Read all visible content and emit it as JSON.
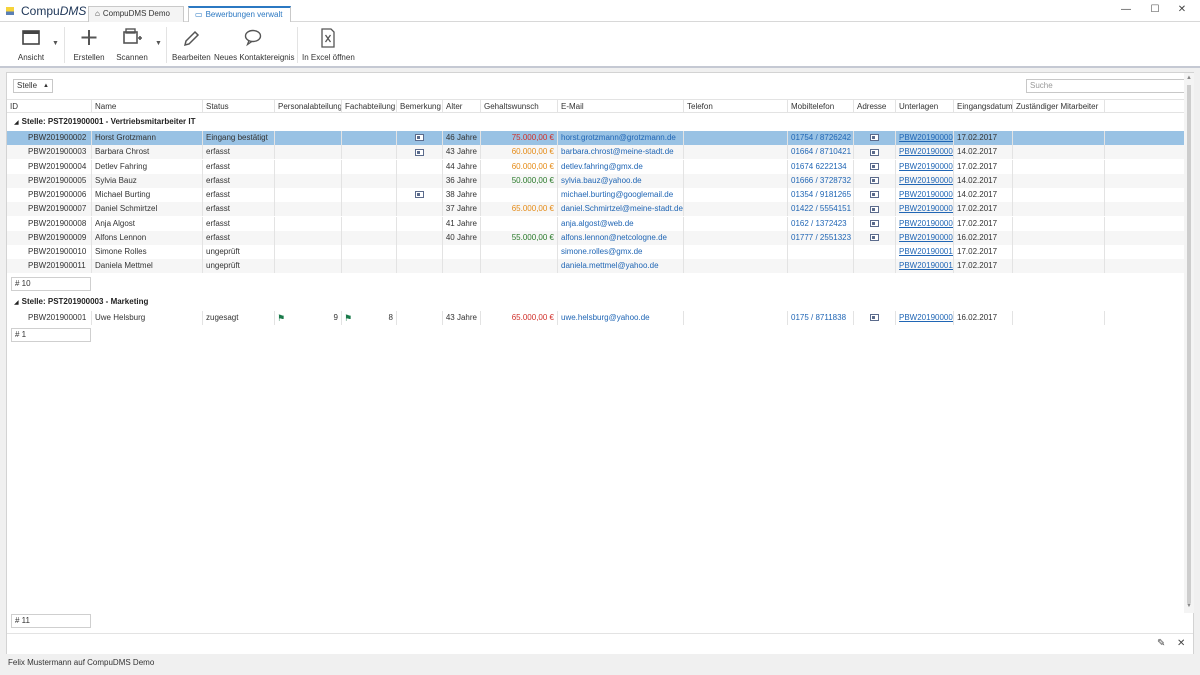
{
  "app": {
    "name_plain": "Compu",
    "name_italic": "DMS",
    "tabs": [
      {
        "label": "CompuDMS Demo",
        "icon": "home-icon"
      },
      {
        "label": "Bewerbungen verwalt",
        "icon": "document-icon"
      }
    ],
    "window_controls": {
      "minimize": "—",
      "maximize": "☐",
      "close": "✕"
    }
  },
  "ribbon": {
    "buttons": [
      {
        "label": "Ansicht",
        "icon": "window-icon",
        "has_dropdown": true
      },
      {
        "label": "Erstellen",
        "icon": "plus-icon",
        "has_dropdown": false
      },
      {
        "label": "Scannen",
        "icon": "scanner-icon",
        "has_dropdown": true
      },
      {
        "label": "Bearbeiten",
        "icon": "pencil-icon",
        "has_dropdown": false
      },
      {
        "label": "Neues Kontaktereignis",
        "icon": "speech-bubble-icon",
        "has_dropdown": false
      },
      {
        "label": "In Excel öffnen",
        "icon": "excel-icon",
        "has_dropdown": false
      }
    ]
  },
  "toolbar": {
    "group_by": "Stelle",
    "search_placeholder": "Suche"
  },
  "columns": [
    "ID",
    "Name",
    "Status",
    "Personalabteilung",
    "Fachabteilung",
    "Bemerkung",
    "Alter",
    "Gehaltswunsch",
    "E-Mail",
    "Telefon",
    "Mobiltelefon",
    "Adresse",
    "Unterlagen",
    "Eingangsdatum",
    "Zuständiger Mitarbeiter"
  ],
  "groups": [
    {
      "title": "Stelle: PST201900001 - Vertriebsmitarbeiter IT",
      "count_label": "# 10",
      "rows": [
        {
          "id": "PBW201900002",
          "name": "Horst Grotzmann",
          "status": "Eingang bestätigt",
          "personal": "",
          "fach": "",
          "bemerkung": true,
          "alter": "46 Jahre",
          "gehalt": "75.000,00 €",
          "gehalt_color": "#d0302a",
          "email": "horst.grotzmann@grotzmann.de",
          "telefon": "",
          "mobil": "01754 / 8726242",
          "adresse": true,
          "unterlagen": "PBW201900002",
          "datum": "17.02.2017",
          "mitarbeiter": "",
          "selected": true
        },
        {
          "id": "PBW201900003",
          "name": "Barbara Chrost",
          "status": "erfasst",
          "personal": "",
          "fach": "",
          "bemerkung": true,
          "alter": "43 Jahre",
          "gehalt": "60.000,00 €",
          "gehalt_color": "#e58b16",
          "email": "barbara.chrost@meine-stadt.de",
          "telefon": "",
          "mobil": "01664 / 8710421",
          "adresse": true,
          "unterlagen": "PBW201900003",
          "datum": "14.02.2017",
          "mitarbeiter": ""
        },
        {
          "id": "PBW201900004",
          "name": "Detlev Fahring",
          "status": "erfasst",
          "personal": "",
          "fach": "",
          "bemerkung": false,
          "alter": "44 Jahre",
          "gehalt": "60.000,00 €",
          "gehalt_color": "#e58b16",
          "email": "detlev.fahring@gmx.de",
          "telefon": "",
          "mobil": "01674 6222134",
          "adresse": true,
          "unterlagen": "PBW201900004",
          "datum": "17.02.2017",
          "mitarbeiter": ""
        },
        {
          "id": "PBW201900005",
          "name": "Sylvia Bauz",
          "status": "erfasst",
          "personal": "",
          "fach": "",
          "bemerkung": false,
          "alter": "36 Jahre",
          "gehalt": "50.000,00 €",
          "gehalt_color": "#2a7a2a",
          "email": "sylvia.bauz@yahoo.de",
          "telefon": "",
          "mobil": "01666 / 3728732",
          "adresse": true,
          "unterlagen": "PBW201900005",
          "datum": "14.02.2017",
          "mitarbeiter": ""
        },
        {
          "id": "PBW201900006",
          "name": "Michael Burting",
          "status": "erfasst",
          "personal": "",
          "fach": "",
          "bemerkung": true,
          "alter": "38 Jahre",
          "gehalt": "",
          "gehalt_color": "#333333",
          "email": "michael.burting@googlemail.de",
          "telefon": "",
          "mobil": "01354 / 9181265",
          "adresse": true,
          "unterlagen": "PBW201900006",
          "datum": "14.02.2017",
          "mitarbeiter": ""
        },
        {
          "id": "PBW201900007",
          "name": "Daniel Schmirtzel",
          "status": "erfasst",
          "personal": "",
          "fach": "",
          "bemerkung": false,
          "alter": "37 Jahre",
          "gehalt": "65.000,00 €",
          "gehalt_color": "#e58b16",
          "email": "daniel.Schmirtzel@meine-stadt.de",
          "telefon": "",
          "mobil": "01422 / 5554151",
          "adresse": true,
          "unterlagen": "PBW201900007",
          "datum": "17.02.2017",
          "mitarbeiter": ""
        },
        {
          "id": "PBW201900008",
          "name": "Anja Algost",
          "status": "erfasst",
          "personal": "",
          "fach": "",
          "bemerkung": false,
          "alter": "41 Jahre",
          "gehalt": "",
          "gehalt_color": "#333333",
          "email": "anja.algost@web.de",
          "telefon": "",
          "mobil": "0162 / 1372423",
          "adresse": true,
          "unterlagen": "PBW201900008",
          "datum": "17.02.2017",
          "mitarbeiter": ""
        },
        {
          "id": "PBW201900009",
          "name": "Alfons Lennon",
          "status": "erfasst",
          "personal": "",
          "fach": "",
          "bemerkung": false,
          "alter": "40 Jahre",
          "gehalt": "55.000,00 €",
          "gehalt_color": "#2a7a2a",
          "email": "alfons.lennon@netcologne.de",
          "telefon": "",
          "mobil": "01777 / 2551323",
          "adresse": true,
          "unterlagen": "PBW201900009",
          "datum": "16.02.2017",
          "mitarbeiter": ""
        },
        {
          "id": "PBW201900010",
          "name": "Simone Rolles",
          "status": "ungeprüft",
          "personal": "",
          "fach": "",
          "bemerkung": false,
          "alter": "",
          "gehalt": "",
          "gehalt_color": "#333333",
          "email": "simone.rolles@gmx.de",
          "telefon": "",
          "mobil": "",
          "adresse": false,
          "unterlagen": "PBW201900010",
          "datum": "17.02.2017",
          "mitarbeiter": ""
        },
        {
          "id": "PBW201900011",
          "name": "Daniela Mettmel",
          "status": "ungeprüft",
          "personal": "",
          "fach": "",
          "bemerkung": false,
          "alter": "",
          "gehalt": "",
          "gehalt_color": "#333333",
          "email": "daniela.mettmel@yahoo.de",
          "telefon": "",
          "mobil": "",
          "adresse": false,
          "unterlagen": "PBW201900011",
          "datum": "17.02.2017",
          "mitarbeiter": ""
        }
      ]
    },
    {
      "title": "Stelle: PST201900003 - Marketing",
      "count_label": "# 1",
      "rows": [
        {
          "id": "PBW201900001",
          "name": "Uwe Helsburg",
          "status": "zugesagt",
          "personal": "9",
          "personal_flag": true,
          "fach": "8",
          "fach_flag": true,
          "bemerkung": false,
          "alter": "43 Jahre",
          "gehalt": "65.000,00 €",
          "gehalt_color": "#d0302a",
          "email": "uwe.helsburg@yahoo.de",
          "telefon": "",
          "mobil": "0175 / 8711838",
          "adresse": true,
          "unterlagen": "PBW201900001",
          "datum": "16.02.2017",
          "mitarbeiter": ""
        }
      ]
    }
  ],
  "total_count_label": "# 11",
  "statusbar": "Felix Mustermann auf CompuDMS Demo"
}
